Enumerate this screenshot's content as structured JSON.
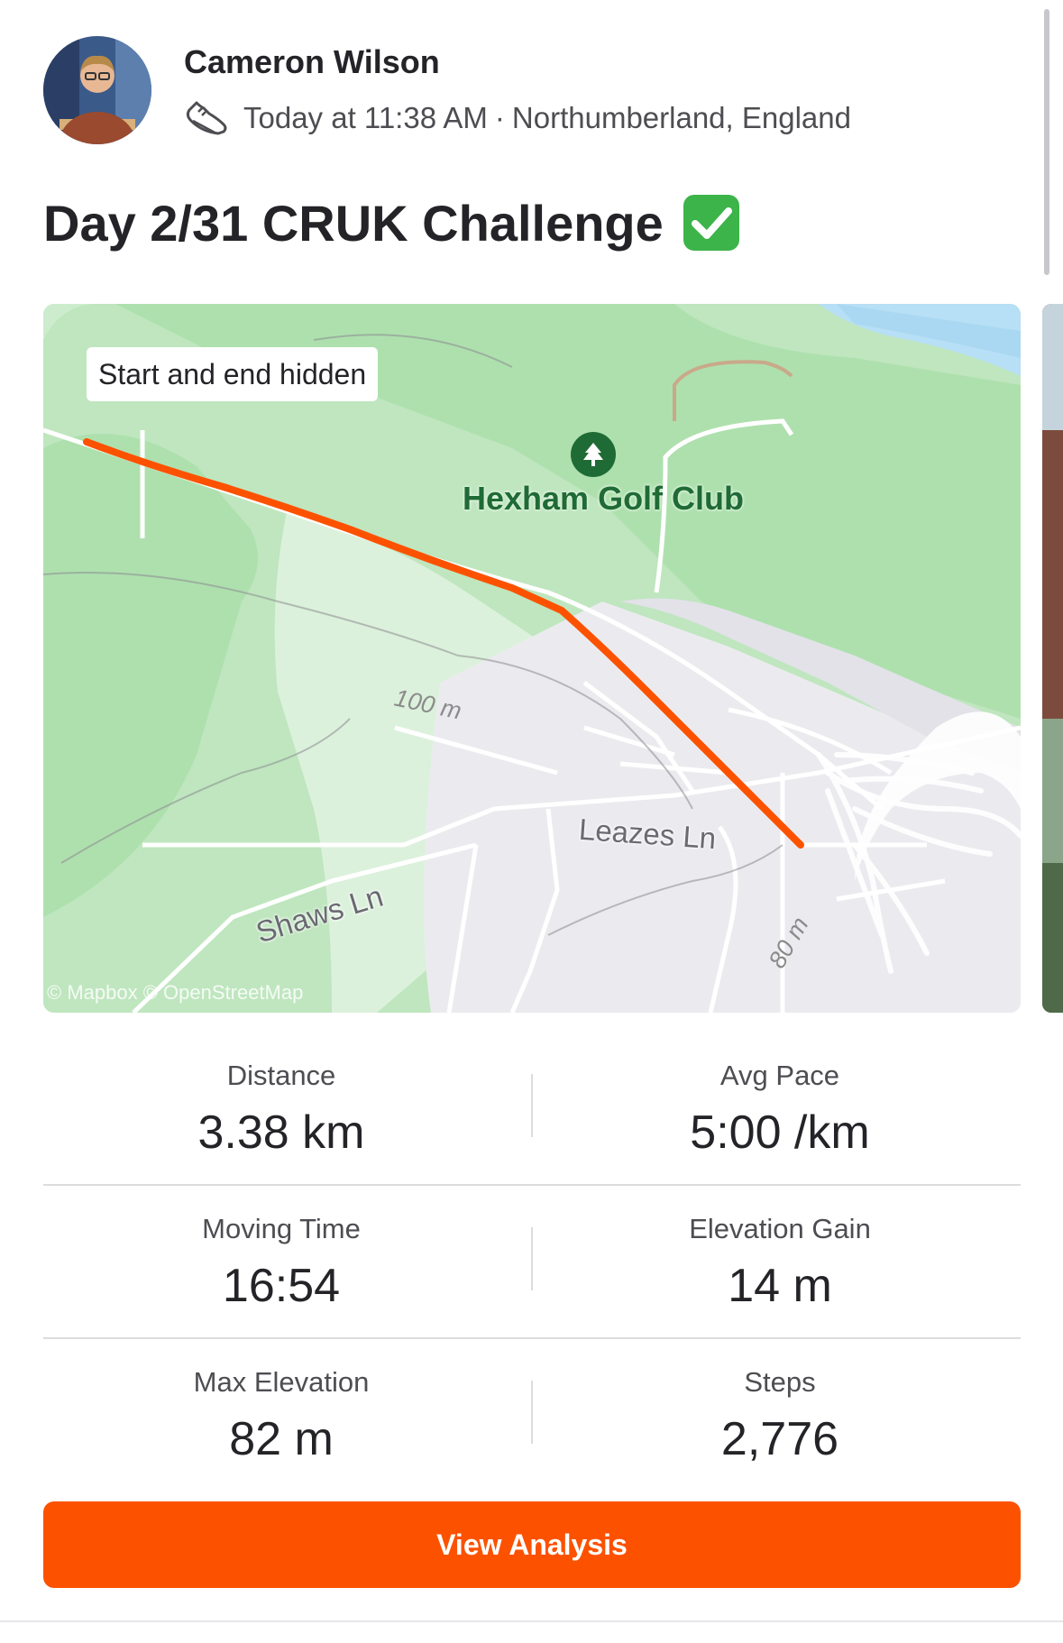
{
  "athlete": {
    "name": "Cameron Wilson",
    "timestamp": "Today at 11:38 AM",
    "separator": "·",
    "location": "Northumberland, England",
    "activity_icon": "shoe-icon"
  },
  "activity": {
    "title": "Day 2/31 CRUK Challenge",
    "title_emoji": "check-mark-button-icon"
  },
  "map": {
    "privacy_label": "Start and end hidden",
    "poi_name": "Hexham Golf Club",
    "poi_icon": "tree-icon",
    "roads": [
      "Leazes Ln",
      "Shaws Ln"
    ],
    "contours": [
      "100 m",
      "80 m"
    ],
    "attribution": "© Mapbox © OpenStreetMap",
    "route_color": "#fc5200"
  },
  "stats": [
    {
      "label": "Distance",
      "value": "3.38 km"
    },
    {
      "label": "Avg Pace",
      "value": "5:00 /km"
    },
    {
      "label": "Moving Time",
      "value": "16:54"
    },
    {
      "label": "Elevation Gain",
      "value": "14 m"
    },
    {
      "label": "Max Elevation",
      "value": "82 m"
    },
    {
      "label": "Steps",
      "value": "2,776"
    }
  ],
  "actions": {
    "view_analysis": "View Analysis"
  },
  "colors": {
    "accent": "#fc5200",
    "text": "#242428",
    "secondary_text": "#4d4d52",
    "poi_green": "#1f6b35"
  }
}
